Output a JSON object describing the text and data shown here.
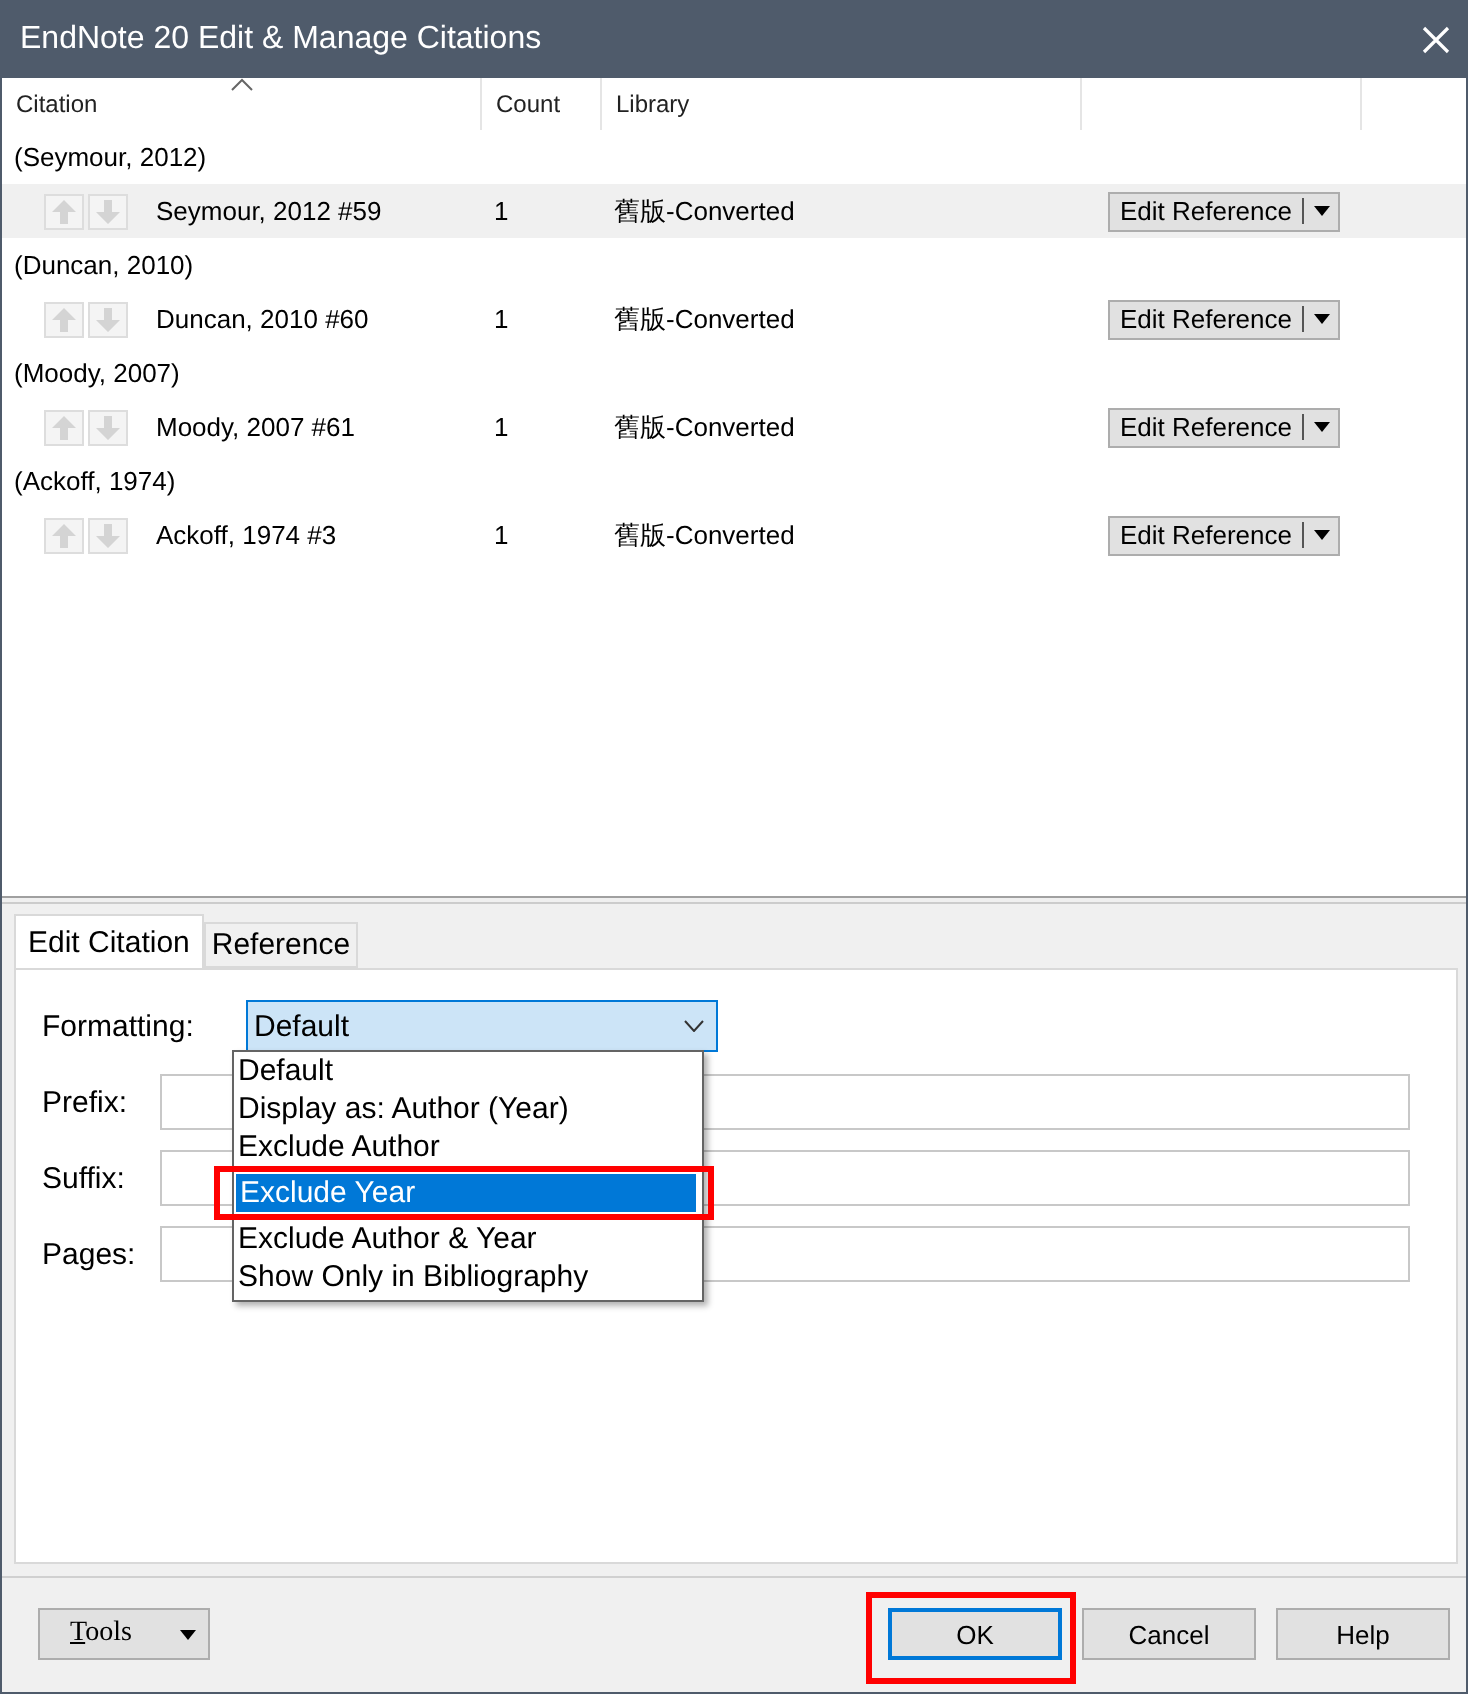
{
  "window": {
    "title": "EndNote 20 Edit & Manage Citations"
  },
  "table": {
    "columns": [
      "Citation",
      "Count",
      "Library"
    ],
    "groups": [
      {
        "citation": "(Seymour, 2012)",
        "reference": {
          "name": "Seymour, 2012 #59",
          "count": "1",
          "library": "舊版-Converted",
          "selected": true,
          "button": "Edit Reference"
        }
      },
      {
        "citation": "(Duncan, 2010)",
        "reference": {
          "name": "Duncan, 2010 #60",
          "count": "1",
          "library": "舊版-Converted",
          "selected": false,
          "button": "Edit Reference"
        }
      },
      {
        "citation": "(Moody, 2007)",
        "reference": {
          "name": "Moody, 2007 #61",
          "count": "1",
          "library": "舊版-Converted",
          "selected": false,
          "button": "Edit Reference"
        }
      },
      {
        "citation": "(Ackoff, 1974)",
        "reference": {
          "name": "Ackoff, 1974 #3",
          "count": "1",
          "library": "舊版-Converted",
          "selected": false,
          "button": "Edit Reference"
        }
      }
    ]
  },
  "tabs": [
    {
      "label": "Edit Citation",
      "selected": true
    },
    {
      "label": "Reference",
      "selected": false
    }
  ],
  "form": {
    "formatting": {
      "label": "Formatting:",
      "value": "Default",
      "expanded": true,
      "options": [
        {
          "label": "Default",
          "highlighted": false
        },
        {
          "label": "Display as: Author (Year)",
          "highlighted": false
        },
        {
          "label": "Exclude Author",
          "highlighted": false
        },
        {
          "label": "Exclude Year",
          "highlighted": true
        },
        {
          "label": "Exclude Author & Year",
          "highlighted": false
        },
        {
          "label": "Show Only in Bibliography",
          "highlighted": false
        }
      ]
    },
    "fields": [
      {
        "label": "Prefix:"
      },
      {
        "label": "Suffix:"
      },
      {
        "label": "Pages:"
      }
    ]
  },
  "footer": {
    "tools": "Tools",
    "buttons": [
      {
        "label": "OK",
        "default": true
      },
      {
        "label": "Cancel",
        "default": false
      },
      {
        "label": "Help",
        "default": false
      }
    ]
  }
}
